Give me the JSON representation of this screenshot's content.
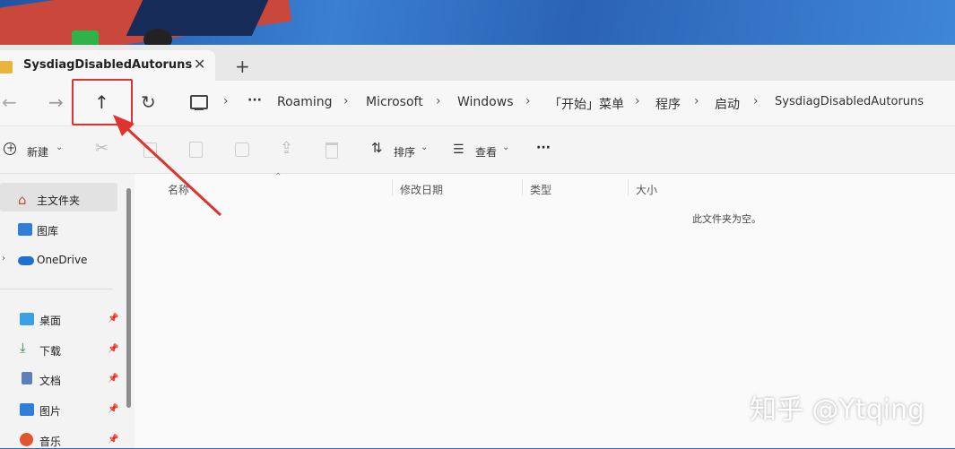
{
  "window": {
    "tab_title": "SysdiagDisabledAutoruns",
    "tab_close": "✕",
    "new_tab": "+"
  },
  "nav": {
    "back": "←",
    "forward": "→",
    "up": "↑",
    "refresh": "↻",
    "more": "···",
    "breadcrumb": [
      "Roaming",
      "Microsoft",
      "Windows",
      "「开始」菜单",
      "程序",
      "启动",
      "SysdiagDisabledAutoruns"
    ],
    "separator": "›"
  },
  "toolbar": {
    "new_label": "新建",
    "sort_label": "排序",
    "view_label": "查看",
    "more": "···"
  },
  "sidebar": {
    "items": [
      {
        "label": "主文件夹",
        "icon": "home-icon"
      },
      {
        "label": "图库",
        "icon": "gallery-icon"
      },
      {
        "label": "OneDrive",
        "icon": "cloud-icon"
      }
    ],
    "pinned": [
      {
        "label": "桌面",
        "icon": "desktop-icon"
      },
      {
        "label": "下载",
        "icon": "download-icon"
      },
      {
        "label": "文档",
        "icon": "document-icon"
      },
      {
        "label": "图片",
        "icon": "pictures-icon"
      },
      {
        "label": "音乐",
        "icon": "music-icon"
      }
    ]
  },
  "columns": [
    "名称",
    "修改日期",
    "类型",
    "大小"
  ],
  "empty_message": "此文件夹为空。",
  "watermark": "知乎 @Ytqing",
  "colors": {
    "highlight": "#e0322e",
    "folder": "#e8b43a",
    "accent": "#1f6fd1"
  }
}
